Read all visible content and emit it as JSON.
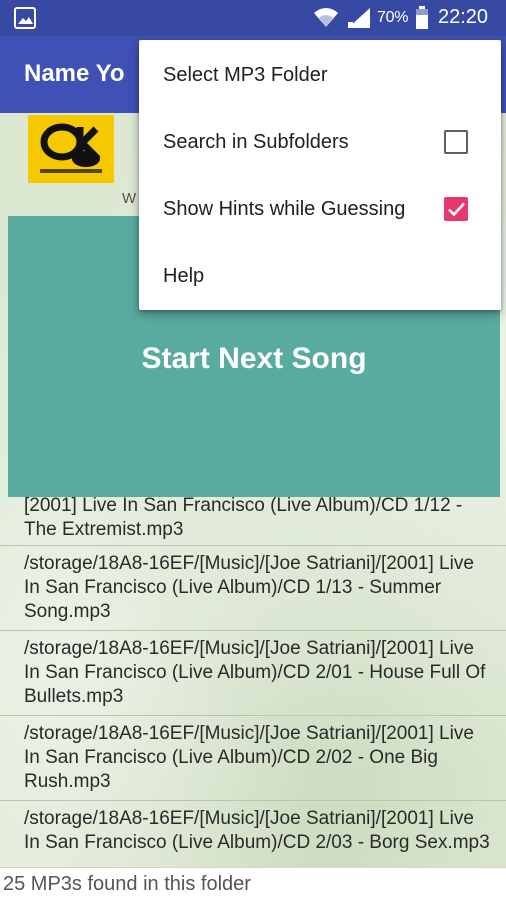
{
  "status_bar": {
    "battery_percent": "70%",
    "time": "22:20",
    "icons": [
      "gallery-icon",
      "wifi-icon",
      "signal-icon",
      "battery-icon"
    ]
  },
  "app_bar": {
    "title": "Name Yo"
  },
  "main": {
    "ad_hint": "W",
    "start_button_label": "Start Next Song",
    "files": [
      "[2001] Live In San Francisco (Live Album)/CD 1/12 - The Extremist.mp3",
      "/storage/18A8-16EF/[Music]/[Joe Satriani]/[2001] Live In San Francisco (Live Album)/CD 1/13 - Summer Song.mp3",
      "/storage/18A8-16EF/[Music]/[Joe Satriani]/[2001] Live In San Francisco (Live Album)/CD 2/01 - House Full Of Bullets.mp3",
      "/storage/18A8-16EF/[Music]/[Joe Satriani]/[2001] Live In San Francisco (Live Album)/CD 2/02 - One Big Rush.mp3",
      "/storage/18A8-16EF/[Music]/[Joe Satriani]/[2001] Live In San Francisco (Live Album)/CD 2/03 - Borg Sex.mp3"
    ],
    "footer_text": "25 MP3s found in this folder"
  },
  "menu": {
    "items": [
      {
        "label": "Select MP3 Folder"
      },
      {
        "label": "Search in Subfolders",
        "checked": false
      },
      {
        "label": "Show Hints while Guessing",
        "checked": true
      },
      {
        "label": "Help"
      }
    ]
  },
  "colors": {
    "status_bar": "#3849a4",
    "app_bar": "#3f51b5",
    "start_button": "#5aab9f",
    "checkbox_checked": "#e8366e"
  }
}
